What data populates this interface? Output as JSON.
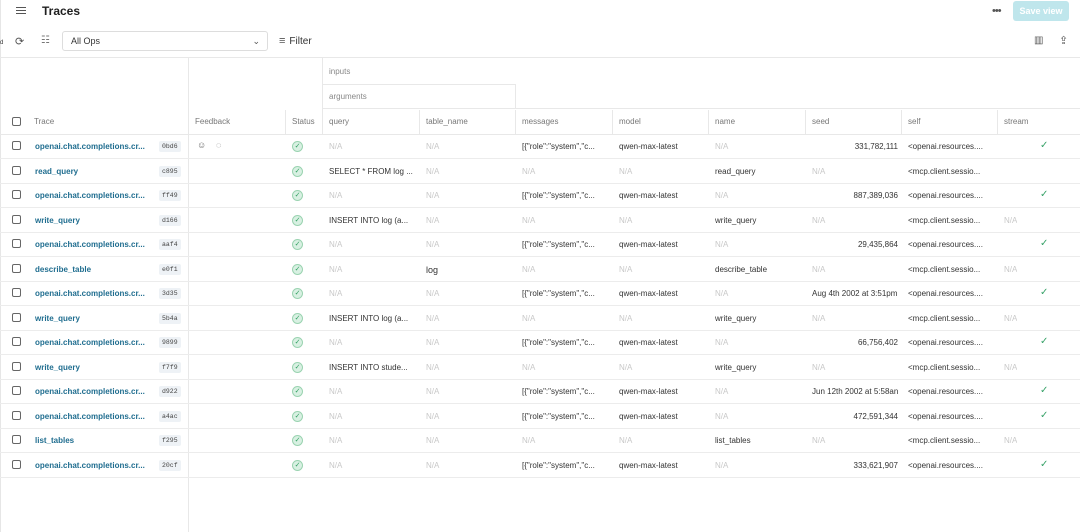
{
  "header": {
    "title": "Traces",
    "save_label": "Save view",
    "more_icon": "more-icon"
  },
  "edge_mark": "d",
  "toolbar": {
    "ops_value": "All Ops",
    "filter_label": "Filter"
  },
  "groups": {
    "inputs": "inputs",
    "arguments": "arguments"
  },
  "columns": {
    "trace": "Trace",
    "feedback": "Feedback",
    "status": "Status",
    "query": "query",
    "table_name": "table_name",
    "messages": "messages",
    "model": "model",
    "name": "name",
    "seed": "seed",
    "self": "self",
    "stream": "stream"
  },
  "na": "N/A",
  "rows": [
    {
      "trace": "openai.chat.completions.cr...",
      "id": "0bd6",
      "query": "N/A",
      "table_name": "N/A",
      "messages": "[{\"role\":\"system\",\"c...",
      "model": "qwen-max-latest",
      "name": "N/A",
      "seed": "331,782,111",
      "self": "<openai.resources....",
      "stream": "✓"
    },
    {
      "trace": "read_query",
      "id": "c895",
      "query": "SELECT * FROM log ...",
      "table_name": "N/A",
      "messages": "N/A",
      "model": "N/A",
      "name": "read_query",
      "seed": "N/A",
      "self": "<mcp.client.sessio...",
      "stream": ""
    },
    {
      "trace": "openai.chat.completions.cr...",
      "id": "ff49",
      "query": "N/A",
      "table_name": "N/A",
      "messages": "[{\"role\":\"system\",\"c...",
      "model": "qwen-max-latest",
      "name": "N/A",
      "seed": "887,389,036",
      "self": "<openai.resources....",
      "stream": "✓"
    },
    {
      "trace": "write_query",
      "id": "d166",
      "query": "INSERT INTO log (a...",
      "table_name": "N/A",
      "messages": "N/A",
      "model": "N/A",
      "name": "write_query",
      "seed": "N/A",
      "self": "<mcp.client.sessio...",
      "stream": "N/A"
    },
    {
      "trace": "openai.chat.completions.cr...",
      "id": "aaf4",
      "query": "N/A",
      "table_name": "N/A",
      "messages": "[{\"role\":\"system\",\"c...",
      "model": "qwen-max-latest",
      "name": "N/A",
      "seed": "29,435,864",
      "self": "<openai.resources....",
      "stream": "✓"
    },
    {
      "trace": "describe_table",
      "id": "e0f1",
      "query": "N/A",
      "table_name": "log",
      "messages": "N/A",
      "model": "N/A",
      "name": "describe_table",
      "seed": "N/A",
      "self": "<mcp.client.sessio...",
      "stream": "N/A"
    },
    {
      "trace": "openai.chat.completions.cr...",
      "id": "3d35",
      "query": "N/A",
      "table_name": "N/A",
      "messages": "[{\"role\":\"system\",\"c...",
      "model": "qwen-max-latest",
      "name": "N/A",
      "seed": "Aug 4th 2002 at 3:51pm",
      "self": "<openai.resources....",
      "stream": "✓"
    },
    {
      "trace": "write_query",
      "id": "5b4a",
      "query": "INSERT INTO log (a...",
      "table_name": "N/A",
      "messages": "N/A",
      "model": "N/A",
      "name": "write_query",
      "seed": "N/A",
      "self": "<mcp.client.sessio...",
      "stream": "N/A"
    },
    {
      "trace": "openai.chat.completions.cr...",
      "id": "9899",
      "query": "N/A",
      "table_name": "N/A",
      "messages": "[{\"role\":\"system\",\"c...",
      "model": "qwen-max-latest",
      "name": "N/A",
      "seed": "66,756,402",
      "self": "<openai.resources....",
      "stream": "✓"
    },
    {
      "trace": "write_query",
      "id": "f7f9",
      "query": "INSERT INTO stude...",
      "table_name": "N/A",
      "messages": "N/A",
      "model": "N/A",
      "name": "write_query",
      "seed": "N/A",
      "self": "<mcp.client.sessio...",
      "stream": "N/A"
    },
    {
      "trace": "openai.chat.completions.cr...",
      "id": "d922",
      "query": "N/A",
      "table_name": "N/A",
      "messages": "[{\"role\":\"system\",\"c...",
      "model": "qwen-max-latest",
      "name": "N/A",
      "seed": "Jun 12th 2002 at 5:58an",
      "self": "<openai.resources....",
      "stream": "✓"
    },
    {
      "trace": "openai.chat.completions.cr...",
      "id": "a4ac",
      "query": "N/A",
      "table_name": "N/A",
      "messages": "[{\"role\":\"system\",\"c...",
      "model": "qwen-max-latest",
      "name": "N/A",
      "seed": "472,591,344",
      "self": "<openai.resources....",
      "stream": "✓"
    },
    {
      "trace": "list_tables",
      "id": "f295",
      "query": "N/A",
      "table_name": "N/A",
      "messages": "N/A",
      "model": "N/A",
      "name": "list_tables",
      "seed": "N/A",
      "self": "<mcp.client.sessio...",
      "stream": "N/A"
    },
    {
      "trace": "openai.chat.completions.cr...",
      "id": "20cf",
      "query": "N/A",
      "table_name": "N/A",
      "messages": "[{\"role\":\"system\",\"c...",
      "model": "qwen-max-latest",
      "name": "N/A",
      "seed": "333,621,907",
      "self": "<openai.resources....",
      "stream": "✓"
    }
  ]
}
